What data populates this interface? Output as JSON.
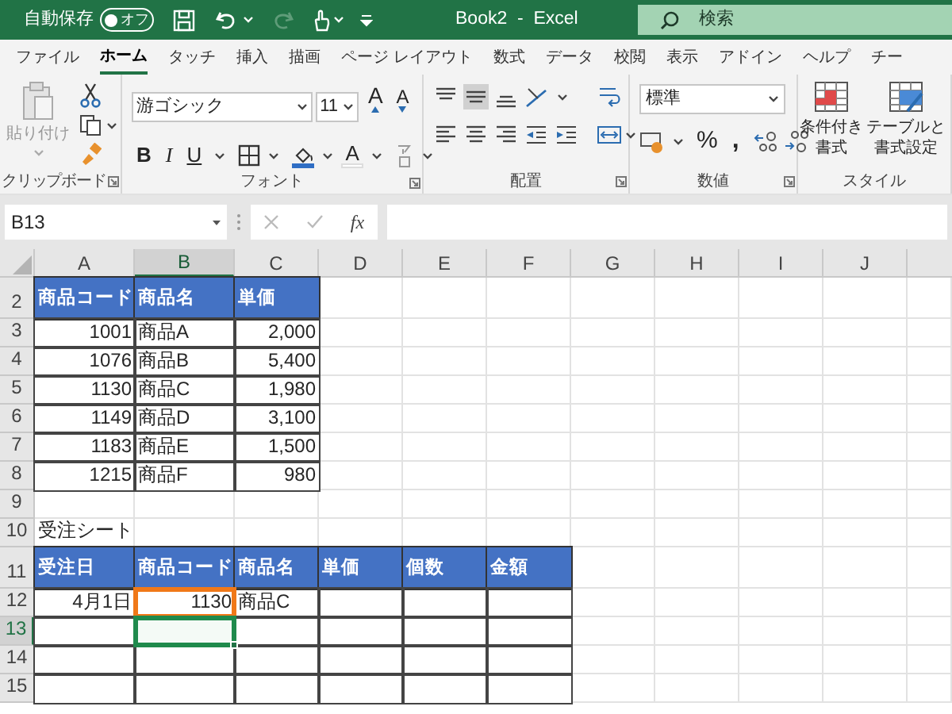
{
  "title_bar": {
    "autosave_label": "自動保存",
    "autosave_toggle": {
      "text": "オフ",
      "on": false
    },
    "redo": {
      "disabled": true
    },
    "title": "Book2  -  Excel",
    "search_placeholder": "検索"
  },
  "tabs": [
    {
      "label": "ファイル",
      "selected": false
    },
    {
      "label": "ホーム",
      "selected": true
    },
    {
      "label": "タッチ",
      "selected": false
    },
    {
      "label": "挿入",
      "selected": false
    },
    {
      "label": "描画",
      "selected": false
    },
    {
      "label": "ページ レイアウト",
      "selected": false
    },
    {
      "label": "数式",
      "selected": false
    },
    {
      "label": "データ",
      "selected": false
    },
    {
      "label": "校閲",
      "selected": false
    },
    {
      "label": "表示",
      "selected": false
    },
    {
      "label": "アドイン",
      "selected": false
    },
    {
      "label": "ヘルプ",
      "selected": false
    },
    {
      "label": "チー",
      "selected": false
    }
  ],
  "ribbon": {
    "groups": [
      "クリップボード",
      "フォント",
      "配置",
      "数値",
      "スタイル"
    ],
    "paste_label": "貼り付け",
    "font_name": "游ゴシック",
    "font_size": "11",
    "grow_font": "A",
    "shrink_font": "A",
    "bold": "B",
    "italic": "I",
    "underline": "U",
    "font_color": "A",
    "number_format": "標準",
    "percent": "%",
    "comma": ",",
    "conditional_format": [
      "条件付き",
      "書式"
    ],
    "format_as_table": [
      "テーブルと",
      "書式設定"
    ]
  },
  "formula_bar": {
    "name_box": "B13",
    "fx": "fx"
  },
  "sheet": {
    "columns": [
      {
        "label": "A",
        "selected": false
      },
      {
        "label": "B",
        "selected": true
      },
      {
        "label": "C",
        "selected": false
      },
      {
        "label": "D",
        "selected": false
      },
      {
        "label": "E",
        "selected": false
      },
      {
        "label": "F",
        "selected": false
      },
      {
        "label": "G",
        "selected": false
      },
      {
        "label": "H",
        "selected": false
      },
      {
        "label": "I",
        "selected": false
      },
      {
        "label": "J",
        "selected": false
      }
    ],
    "rows": [
      {
        "number": "2",
        "selected": false,
        "cells": [
          {
            "text": "商品コード",
            "kind": "header",
            "active": false,
            "highlighted": false
          },
          {
            "text": "商品名",
            "kind": "header",
            "active": false,
            "highlighted": false
          },
          {
            "text": "単価",
            "kind": "header",
            "active": false,
            "highlighted": false
          }
        ]
      },
      {
        "number": "3",
        "selected": false,
        "cells": [
          {
            "text": "1001",
            "kind": "number",
            "active": false,
            "highlighted": false
          },
          {
            "text": "商品A",
            "kind": "text",
            "active": false,
            "highlighted": false
          },
          {
            "text": "2,000",
            "kind": "number",
            "active": false,
            "highlighted": false
          }
        ]
      },
      {
        "number": "4",
        "selected": false,
        "cells": [
          {
            "text": "1076",
            "kind": "number",
            "active": false,
            "highlighted": false
          },
          {
            "text": "商品B",
            "kind": "text",
            "active": false,
            "highlighted": false
          },
          {
            "text": "5,400",
            "kind": "number",
            "active": false,
            "highlighted": false
          }
        ]
      },
      {
        "number": "5",
        "selected": false,
        "cells": [
          {
            "text": "1130",
            "kind": "number",
            "active": false,
            "highlighted": false
          },
          {
            "text": "商品C",
            "kind": "text",
            "active": false,
            "highlighted": false
          },
          {
            "text": "1,980",
            "kind": "number",
            "active": false,
            "highlighted": false
          }
        ]
      },
      {
        "number": "6",
        "selected": false,
        "cells": [
          {
            "text": "1149",
            "kind": "number",
            "active": false,
            "highlighted": false
          },
          {
            "text": "商品D",
            "kind": "text",
            "active": false,
            "highlighted": false
          },
          {
            "text": "3,100",
            "kind": "number",
            "active": false,
            "highlighted": false
          }
        ]
      },
      {
        "number": "7",
        "selected": false,
        "cells": [
          {
            "text": "1183",
            "kind": "number",
            "active": false,
            "highlighted": false
          },
          {
            "text": "商品E",
            "kind": "text",
            "active": false,
            "highlighted": false
          },
          {
            "text": "1,500",
            "kind": "number",
            "active": false,
            "highlighted": false
          }
        ]
      },
      {
        "number": "8",
        "selected": false,
        "cells": [
          {
            "text": "1215",
            "kind": "number",
            "active": false,
            "highlighted": false
          },
          {
            "text": "商品F",
            "kind": "text",
            "active": false,
            "highlighted": false
          },
          {
            "text": "980",
            "kind": "number",
            "active": false,
            "highlighted": false
          }
        ]
      },
      {
        "number": "9",
        "selected": false,
        "cells": []
      },
      {
        "number": "10",
        "selected": false,
        "cells": [
          {
            "text": "受注シート",
            "kind": "label",
            "active": false,
            "highlighted": false
          }
        ]
      },
      {
        "number": "11",
        "selected": false,
        "cells": [
          {
            "text": "受注日",
            "kind": "header",
            "active": false,
            "highlighted": false
          },
          {
            "text": "商品コード",
            "kind": "header",
            "active": false,
            "highlighted": false
          },
          {
            "text": "商品名",
            "kind": "header",
            "active": false,
            "highlighted": false
          },
          {
            "text": "単価",
            "kind": "header",
            "active": false,
            "highlighted": false
          },
          {
            "text": "個数",
            "kind": "header",
            "active": false,
            "highlighted": false
          },
          {
            "text": "金額",
            "kind": "header",
            "active": false,
            "highlighted": false
          }
        ]
      },
      {
        "number": "12",
        "selected": false,
        "cells": [
          {
            "text": "4月1日",
            "kind": "number",
            "active": false,
            "highlighted": false
          },
          {
            "text": "1130",
            "kind": "number",
            "active": false,
            "highlighted": true
          },
          {
            "text": "商品C",
            "kind": "text",
            "active": false,
            "highlighted": false
          },
          {
            "kind": "blank",
            "active": false,
            "highlighted": false
          },
          {
            "kind": "blank",
            "active": false,
            "highlighted": false
          },
          {
            "kind": "blank",
            "active": false,
            "highlighted": false
          }
        ]
      },
      {
        "number": "13",
        "selected": true,
        "cells": [
          {
            "kind": "blank",
            "active": false,
            "highlighted": false
          },
          {
            "kind": "blank",
            "active": true,
            "highlighted": false
          },
          {
            "kind": "blank",
            "active": false,
            "highlighted": false
          },
          {
            "kind": "blank",
            "active": false,
            "highlighted": false
          },
          {
            "kind": "blank",
            "active": false,
            "highlighted": false
          },
          {
            "kind": "blank",
            "active": false,
            "highlighted": false
          }
        ]
      },
      {
        "number": "14",
        "selected": false,
        "cells": [
          {
            "kind": "blank",
            "active": false,
            "highlighted": false
          },
          {
            "kind": "blank",
            "active": false,
            "highlighted": false
          },
          {
            "kind": "blank",
            "active": false,
            "highlighted": false
          },
          {
            "kind": "blank",
            "active": false,
            "highlighted": false
          },
          {
            "kind": "blank",
            "active": false,
            "highlighted": false
          },
          {
            "kind": "blank",
            "active": false,
            "highlighted": false
          }
        ]
      },
      {
        "number": "15",
        "selected": false,
        "cells": [
          {
            "kind": "blank",
            "active": false,
            "highlighted": false
          },
          {
            "kind": "blank",
            "active": false,
            "highlighted": false
          },
          {
            "kind": "blank",
            "active": false,
            "highlighted": false
          },
          {
            "kind": "blank",
            "active": false,
            "highlighted": false
          },
          {
            "kind": "blank",
            "active": false,
            "highlighted": false
          },
          {
            "kind": "blank",
            "active": false,
            "highlighted": false
          }
        ]
      }
    ]
  }
}
